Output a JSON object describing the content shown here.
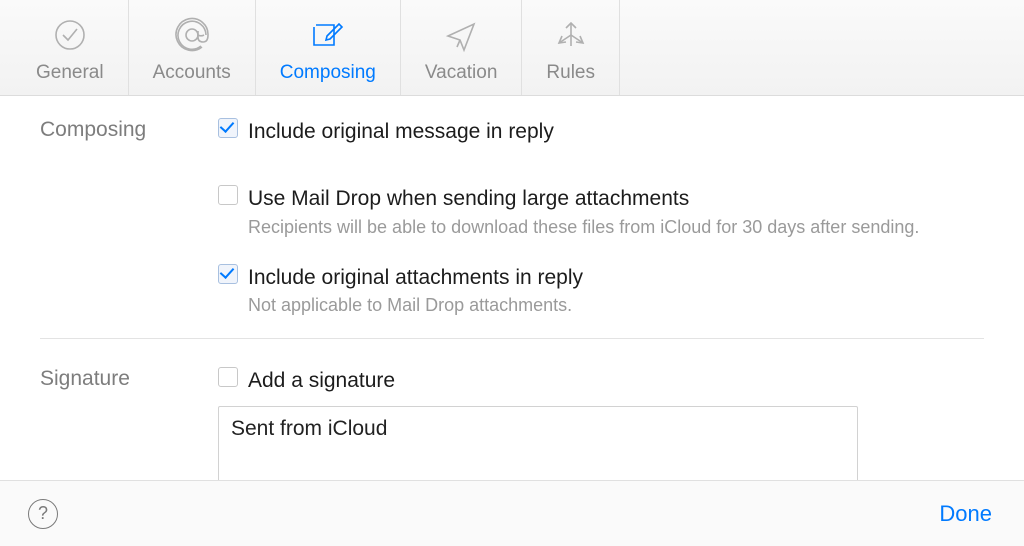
{
  "tabs": {
    "general": {
      "label": "General"
    },
    "accounts": {
      "label": "Accounts"
    },
    "composing": {
      "label": "Composing",
      "active": true
    },
    "vacation": {
      "label": "Vacation"
    },
    "rules": {
      "label": "Rules"
    }
  },
  "sections": {
    "composing": {
      "title": "Composing",
      "include_reply": {
        "checked": true,
        "label": "Include original message in reply"
      },
      "mail_drop": {
        "checked": false,
        "label": "Use Mail Drop when sending large attachments",
        "hint": "Recipients will be able to download these files from iCloud for 30 days after sending."
      },
      "include_attachments": {
        "checked": true,
        "label": "Include original attachments in reply",
        "hint": "Not applicable to Mail Drop attachments."
      }
    },
    "signature": {
      "title": "Signature",
      "add_signature": {
        "checked": false,
        "label": "Add a signature"
      },
      "signature_text": "Sent from iCloud"
    }
  },
  "footer": {
    "help_glyph": "?",
    "done_label": "Done"
  },
  "colors": {
    "accent": "#007aff",
    "muted": "#8a8a8a"
  }
}
